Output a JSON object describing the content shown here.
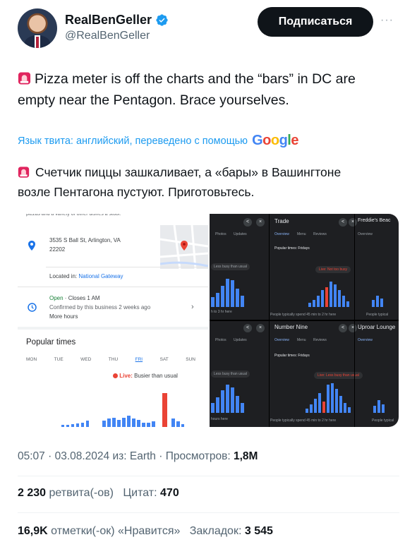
{
  "author": {
    "display_name": "RealBenGeller",
    "handle": "@RealBenGeller"
  },
  "actions": {
    "subscribe_label": "Подписаться",
    "more_label": "···"
  },
  "tweet": {
    "text_line1": "Pizza meter is off the charts and the “bars” in DC are",
    "text_line2": "empty near the Pentagon. Brace yourselves.",
    "translate_note": "Язык твита: английский, переведено с помощью",
    "translate_service": "Google",
    "translated_line1": "Счетчик пиццы зашкаливает, а «бары» в Вашингтоне",
    "translated_line2": "возле Пентагона пустуют. Приготовьтесь."
  },
  "media": {
    "left_panel": {
      "address_line1": "3535 S Ball St, Arlington, VA",
      "address_line2": "22202",
      "located_in_prefix": "Located in: ",
      "located_in_place": "National Gateway",
      "hours_open": "Open",
      "hours_close": " · Closes 1 AM",
      "hours_confirmed": "Confirmed by this business 2 weeks ago",
      "more_hours": "More hours",
      "popular_title": "Popular times",
      "days": [
        "MON",
        "TUE",
        "WED",
        "THU",
        "FRI",
        "SAT",
        "SUN"
      ],
      "live_label": "Live:",
      "live_text": " Busier than usual"
    },
    "right_panels": {
      "top_left_title": "Trade",
      "top_right_title": "Freddie's Beac",
      "bottom_left_title": "Number Nine",
      "bottom_right_title": "Uproar Lounge",
      "tabs": [
        "Photos",
        "Updates",
        "Overview",
        "Menu",
        "Reviews",
        "Photos",
        "Updates"
      ],
      "popular_friday": "Popular times: Fridays",
      "live_not_busy": "Live: Not too busy",
      "live_less_busy": "Live: Less busy than usual",
      "less_busy": "Less busy than usual",
      "people_spend_1": "People typically spend 45 min to 2 hr here",
      "people_spend_2": "People typically spend 45 min to 2 hr here",
      "left_hours": "h to 3 hr here",
      "left_hours2": "hours here",
      "people_typical": "People typical"
    }
  },
  "meta": {
    "time": "05:07",
    "date": "03.08.2024",
    "source_prefix": "из:",
    "source": "Earth",
    "views_label": "Просмотров:",
    "views_value": "1,8M"
  },
  "stats": {
    "retweets_value": "2 230",
    "retweets_label": "ретвита(-ов)",
    "quotes_label": "Цитат:",
    "quotes_value": "470",
    "likes_value": "16,9K",
    "likes_label": "отметки(-ок) «Нравится»",
    "bookmarks_label": "Закладок:",
    "bookmarks_value": "3 545"
  },
  "colors": {
    "accent_blue": "#1d9bf0",
    "bar_blue": "#4285f4",
    "live_red": "#ea4335",
    "button_black": "#0f1419"
  }
}
